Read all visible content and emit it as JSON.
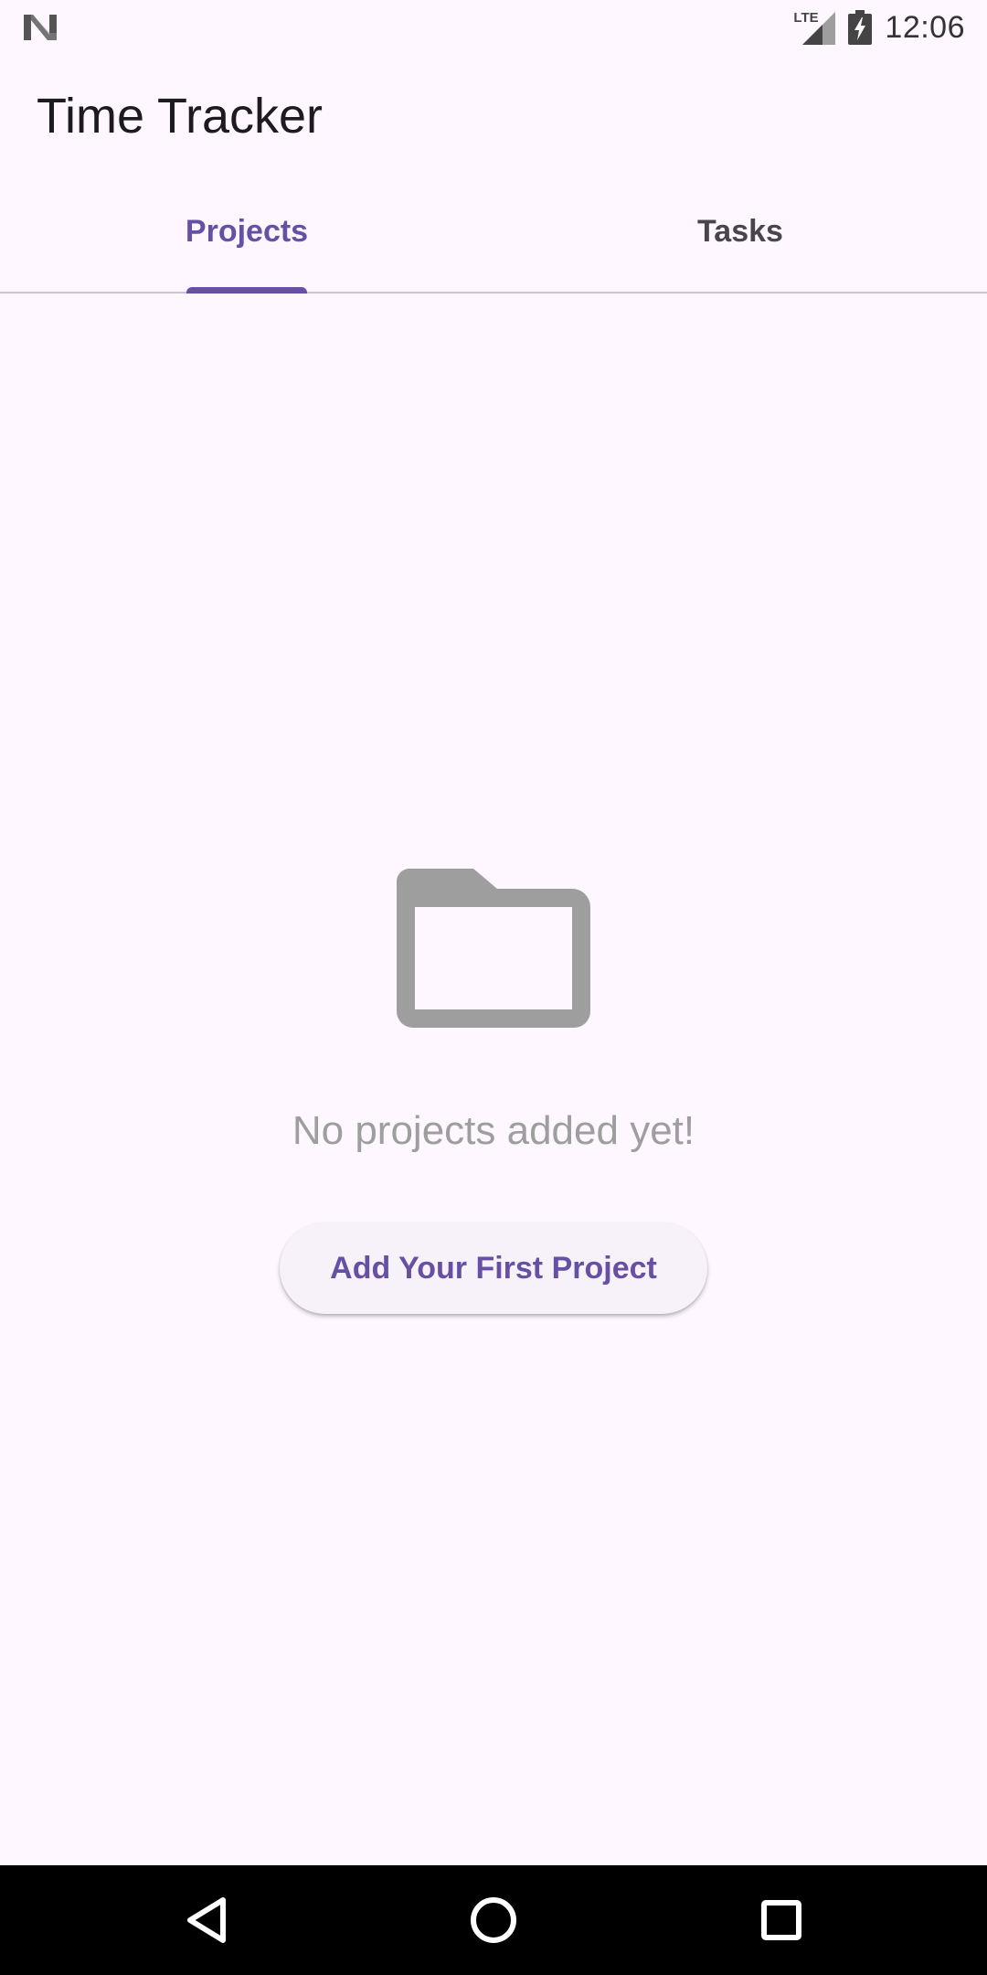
{
  "status_bar": {
    "time": "12:06",
    "network_label": "LTE",
    "icons": [
      "n-logo-icon",
      "signal-icon",
      "battery-charging-icon"
    ]
  },
  "app_bar": {
    "title": "Time Tracker"
  },
  "tabs": [
    {
      "label": "Projects",
      "active": true
    },
    {
      "label": "Tasks",
      "active": false
    }
  ],
  "empty_state": {
    "icon": "folder-icon",
    "message": "No projects added yet!",
    "button_label": "Add Your First Project"
  },
  "nav_bar": {
    "icons": [
      "back-icon",
      "home-icon",
      "recents-icon"
    ]
  },
  "colors": {
    "background": "#fef7ff",
    "accent": "#6750a4",
    "muted_text": "#9e9e9e",
    "icon_gray": "#9e9e9e",
    "button_surface": "#f7f2fa",
    "nav_bar": "#000000"
  }
}
